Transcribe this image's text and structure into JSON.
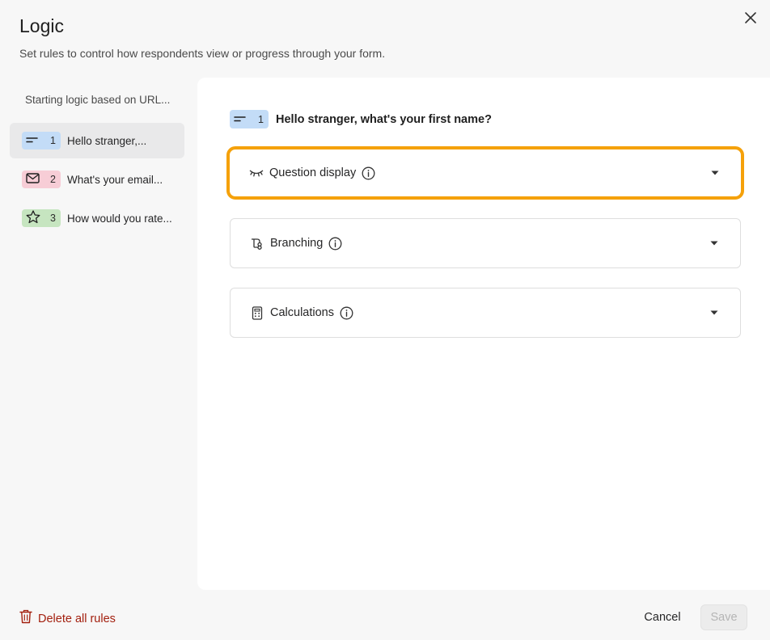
{
  "dialog": {
    "title": "Logic",
    "subtitle": "Set rules to control how respondents view or progress through your form.",
    "close_icon": "close-icon"
  },
  "sidebar": {
    "heading": "Starting logic based on URL...",
    "items": [
      {
        "number": "1",
        "label": "Hello stranger,...",
        "icon": "short-text-icon",
        "color": "#c3dcf7",
        "active": true
      },
      {
        "number": "2",
        "label": "What's your email...",
        "icon": "envelope-icon",
        "color": "#f7cdd6",
        "active": false
      },
      {
        "number": "3",
        "label": "How would you rate...",
        "icon": "star-icon",
        "color": "#c6e5c0",
        "active": false
      }
    ]
  },
  "main": {
    "question": {
      "number": "1",
      "text": "Hello stranger, what's your first name?",
      "icon": "short-text-icon"
    },
    "panels": [
      {
        "label": "Question display",
        "icon": "eye-closed-icon",
        "highlighted": true
      },
      {
        "label": "Branching",
        "icon": "branching-icon",
        "highlighted": false
      },
      {
        "label": "Calculations",
        "icon": "calculator-icon",
        "highlighted": false
      }
    ]
  },
  "footer": {
    "delete_label": "Delete all rules",
    "cancel_label": "Cancel",
    "save_label": "Save"
  },
  "colors": {
    "highlight": "#f5a10a",
    "delete": "#a3200f",
    "background": "#f7f7f7"
  }
}
